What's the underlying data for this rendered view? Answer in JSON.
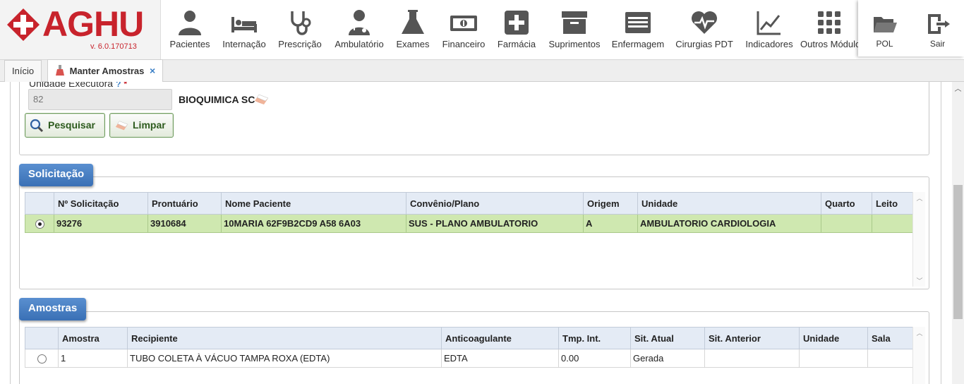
{
  "app": {
    "logo_text": "AGHU",
    "version": "v. 6.0.170713"
  },
  "colors": {
    "brand_red": "#c8232c",
    "legend_blue": "#3a70b5",
    "selected_row": "#cfe8b0",
    "button_text": "#2d5b1e"
  },
  "menu": {
    "items": [
      {
        "label": "Pacientes",
        "icon": "patient-icon"
      },
      {
        "label": "Internação",
        "icon": "bed-icon"
      },
      {
        "label": "Prescrição",
        "icon": "stethoscope-icon"
      },
      {
        "label": "Ambulatório",
        "icon": "doctor-icon"
      },
      {
        "label": "Exames",
        "icon": "flask-icon"
      },
      {
        "label": "Financeiro",
        "icon": "money-icon"
      },
      {
        "label": "Farmácia",
        "icon": "plus-box-icon"
      },
      {
        "label": "Suprimentos",
        "icon": "archive-box-icon"
      },
      {
        "label": "Enfermagem",
        "icon": "list-board-icon"
      },
      {
        "label": "Cirurgias PDT",
        "icon": "heart-pulse-icon"
      },
      {
        "label": "Indicadores",
        "icon": "line-chart-icon"
      },
      {
        "label": "Outros Módulos",
        "icon": "grid-icon"
      }
    ],
    "right": [
      {
        "label": "POL",
        "icon": "folder-icon"
      },
      {
        "label": "Sair",
        "icon": "exit-icon"
      }
    ]
  },
  "tabs": {
    "home": "Início",
    "active": "Manter Amostras",
    "close": "×"
  },
  "filter": {
    "label": "Unidade Executora",
    "help": "?",
    "required": "*",
    "code_value": "82",
    "unit_name": "BIOQUIMICA SC",
    "search_label": "Pesquisar",
    "clear_label": "Limpar"
  },
  "solicitacao": {
    "legend": "Solicitação",
    "columns": [
      "Nº Solicitação",
      "Prontuário",
      "Nome Paciente",
      "Convênio/Plano",
      "Origem",
      "Unidade",
      "Quarto",
      "Leito"
    ],
    "rows": [
      [
        "93276",
        "3910684",
        "10MARIA 62F9B2CD9 A58 6A03",
        "SUS - PLANO AMBULATORIO",
        "A",
        "AMBULATORIO CARDIOLOGIA",
        "",
        ""
      ]
    ]
  },
  "amostras": {
    "legend": "Amostras",
    "columns": [
      "Amostra",
      "Recipiente",
      "Anticoagulante",
      "Tmp. Int.",
      "Sit. Atual",
      "Sit. Anterior",
      "Unidade",
      "Sala"
    ],
    "rows": [
      [
        "1",
        "TUBO COLETA À VÁCUO TAMPA ROXA (EDTA)",
        "EDTA",
        "0.00",
        "Gerada",
        "",
        "",
        ""
      ]
    ]
  }
}
